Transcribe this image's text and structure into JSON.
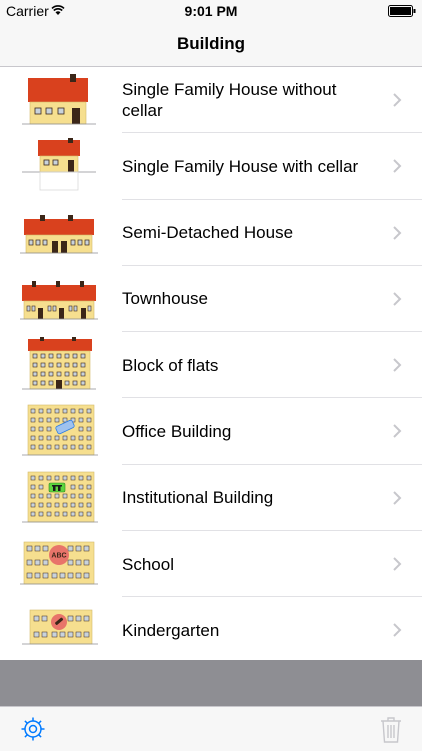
{
  "status": {
    "carrier": "Carrier",
    "time": "9:01 PM"
  },
  "nav": {
    "title": "Building"
  },
  "rows": [
    {
      "label": "Single Family House without cellar",
      "icon": "single-family-house-icon"
    },
    {
      "label": "Single Family House with cellar",
      "icon": "single-family-house-cellar-icon"
    },
    {
      "label": "Semi-Detached House",
      "icon": "semi-detached-house-icon"
    },
    {
      "label": "Townhouse",
      "icon": "townhouse-icon"
    },
    {
      "label": "Block of flats",
      "icon": "block-of-flats-icon"
    },
    {
      "label": "Office Building",
      "icon": "office-building-icon"
    },
    {
      "label": "Institutional Building",
      "icon": "institutional-building-icon"
    },
    {
      "label": "School",
      "icon": "school-icon"
    },
    {
      "label": "Kindergarten",
      "icon": "kindergarten-icon"
    }
  ],
  "school_badge": "ABC",
  "toolbar": {
    "settings_icon": "gear-icon",
    "trash_icon": "trash-icon"
  },
  "colors": {
    "wall": "#f6df8f",
    "roof": "#d9411e",
    "window": "#c9d3dc",
    "door": "#3b2618",
    "accent_blue": "#2a7be4",
    "separator": "#e1e1e5"
  }
}
